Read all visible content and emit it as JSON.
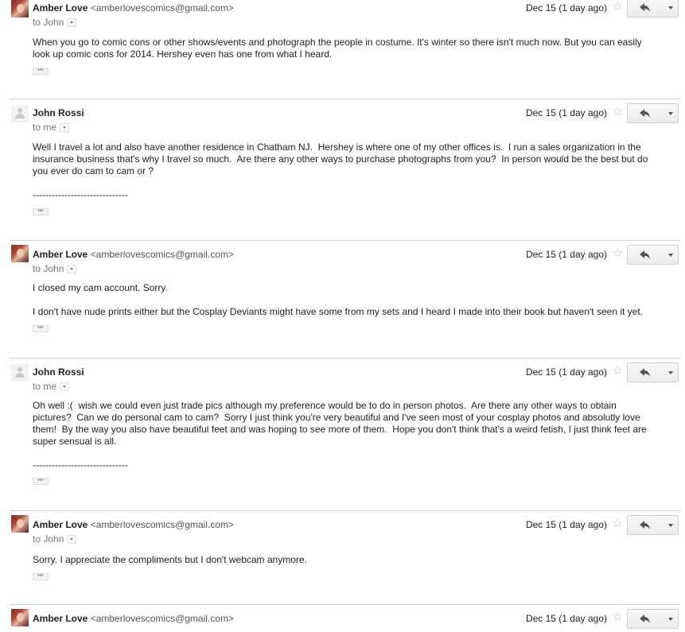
{
  "messages": [
    {
      "sender_name": "Amber Love",
      "sender_email": "<amberlovescomics@gmail.com>",
      "to": "to John",
      "date": "Dec 15 (1 day ago)",
      "body": "When you go to comic cons or other shows/events and photograph the people in costume. It's winter so there isn't much now. But you can easily\nlook up comic cons for 2014. Hershey even has one from what I heard."
    },
    {
      "sender_name": "John Rossi",
      "sender_email": "",
      "to": "to me",
      "date": "Dec 15 (1 day ago)",
      "body": "Well I travel a lot and also have another residence in Chatham NJ.  Hershey is where one of my other offices is.  I run a sales organization in the\ninsurance business that's why I travel so much.  Are there any other ways to purchase photographs from you?  In person would be the best but do\nyou ever do cam to cam or ?\n\n------------------------------"
    },
    {
      "sender_name": "Amber Love",
      "sender_email": "<amberlovescomics@gmail.com>",
      "to": "to John",
      "date": "Dec 15 (1 day ago)",
      "body": "I closed my cam account. Sorry.\n\nI don't have nude prints either but the Cosplay Deviants might have some from my sets and I heard I made into their book but haven't seen it yet."
    },
    {
      "sender_name": "John Rossi",
      "sender_email": "",
      "to": "to me",
      "date": "Dec 15 (1 day ago)",
      "body": "Oh well :(  wish we could even just trade pics although my preference would be to do in person photos.  Are there any other ways to obtain\npictures?  Can we do personal cam to cam?  Sorry I just think you're very beautiful and I've seen most of your cosplay photos and absolutly love\nthem!  By the way you also have beautiful feet and was hoping to see more of them.  Hope you don't think that's a weird fetish, I just think feet are\nsuper sensual is all.\n\n------------------------------"
    },
    {
      "sender_name": "Amber Love",
      "sender_email": "<amberlovescomics@gmail.com>",
      "to": "to John",
      "date": "Dec 15 (1 day ago)",
      "body": "Sorry. I appreciate the compliments but I don't webcam anymore."
    },
    {
      "sender_name": "Amber Love",
      "sender_email": "<amberlovescomics@gmail.com>",
      "to": "",
      "date": "Dec 15 (1 day ago)",
      "body": ""
    }
  ],
  "ellipsis_label": "•••",
  "star_glyph": "☆",
  "icons": {
    "reply": "reply-icon",
    "more": "chevron-down-icon",
    "star": "star-icon"
  }
}
